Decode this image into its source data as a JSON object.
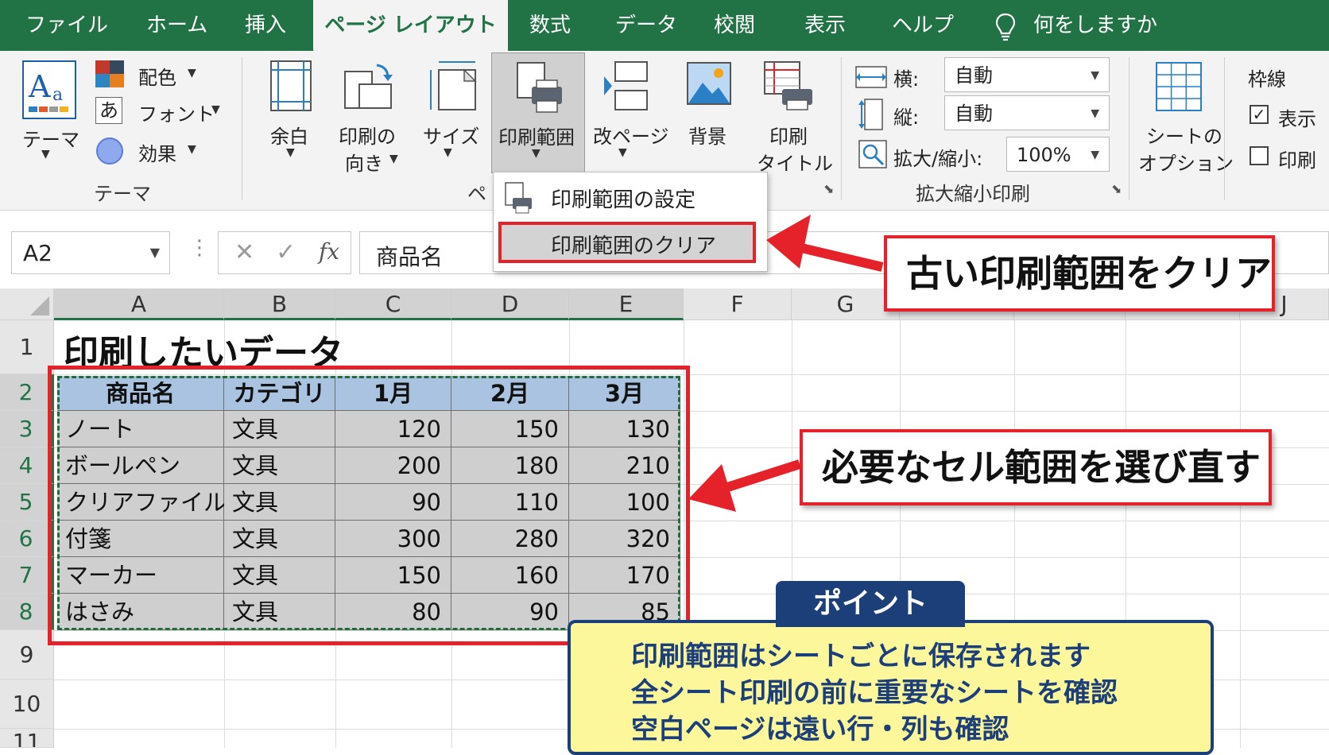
{
  "tabs": [
    "ファイル",
    "ホーム",
    "挿入",
    "ページ レイアウト",
    "数式",
    "データ",
    "校閲",
    "表示",
    "ヘルプ"
  ],
  "tell_me": "何をしますか",
  "ribbon": {
    "theme_group": {
      "theme_label": "テーマ",
      "colors": "配色",
      "fonts": "フォント",
      "effects": "効果",
      "group_label": "テーマ",
      "font_icon_char": "あ"
    },
    "page_setup": {
      "margins": "余白",
      "orientation_1": "印刷の",
      "orientation_2": "向き",
      "size": "サイズ",
      "print_area": "印刷範囲",
      "breaks": "改ページ",
      "background": "背景",
      "print_titles_1": "印刷",
      "print_titles_2": "タイトル",
      "group_label_partial": "ペ"
    },
    "scale_to_fit": {
      "width_label": "横:",
      "width_value": "自動",
      "height_label": "縦:",
      "height_value": "自動",
      "scale_label": "拡大/縮小:",
      "scale_value": "100%",
      "group_label": "拡大縮小印刷"
    },
    "sheet_options": {
      "label_1": "シートの",
      "label_2": "オプション"
    },
    "gridlines": {
      "title": "枠線",
      "view": "表示",
      "view_checked": true,
      "print": "印刷",
      "print_checked": false
    }
  },
  "menu": {
    "set_print_area": "印刷範囲の設定",
    "clear_print_area": "印刷範囲のクリア"
  },
  "formula_bar": {
    "name_box": "A2",
    "fx": "fx",
    "content": "商品名"
  },
  "columns": [
    "A",
    "B",
    "C",
    "D",
    "E",
    "F",
    "G",
    "J"
  ],
  "rows": [
    "1",
    "2",
    "3",
    "4",
    "5",
    "6",
    "7",
    "8",
    "9",
    "10",
    "11"
  ],
  "sheet": {
    "title": "印刷したいデータ",
    "headers": [
      "商品名",
      "カテゴリ",
      "1月",
      "2月",
      "3月"
    ],
    "data": [
      [
        "ノート",
        "文具",
        "120",
        "150",
        "130"
      ],
      [
        "ボールペン",
        "文具",
        "200",
        "180",
        "210"
      ],
      [
        "クリアファイル",
        "文具",
        "90",
        "110",
        "100"
      ],
      [
        "付箋",
        "文具",
        "300",
        "280",
        "320"
      ],
      [
        "マーカー",
        "文具",
        "150",
        "160",
        "170"
      ],
      [
        "はさみ",
        "文具",
        "80",
        "90",
        "85"
      ]
    ]
  },
  "callouts": {
    "clear": "古い印刷範囲をクリア",
    "reselect": "必要なセル範囲を選び直す"
  },
  "point": {
    "title": "ポイント",
    "lines": [
      "印刷範囲はシートごとに保存されます",
      "全シート印刷の前に重要なシートを確認",
      "空白ページは遠い行・列も確認"
    ]
  },
  "colors": {
    "excel_green": "#217346",
    "highlight_red": "#e5222a",
    "header_blue": "#a9c3e0",
    "point_navy": "#1c3f7a",
    "point_yellow": "#fdf79b"
  }
}
